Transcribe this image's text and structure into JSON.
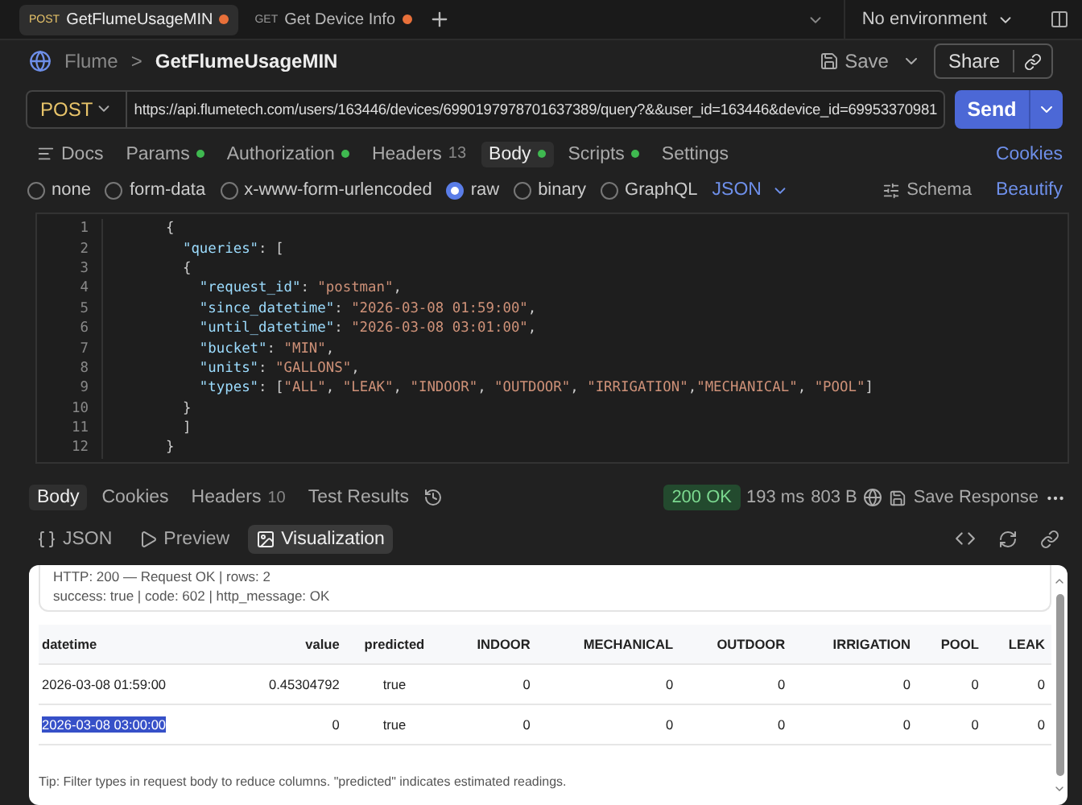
{
  "tabs": [
    {
      "method": "POST",
      "label": "GetFlumeUsageMIN",
      "selected": true,
      "unsaved": true
    },
    {
      "method": "GET",
      "label": "Get Device Info",
      "selected": false,
      "unsaved": true
    }
  ],
  "environment": "No environment",
  "breadcrumb": {
    "collection": "Flume",
    "separator": ">",
    "request": "GetFlumeUsageMIN"
  },
  "header_actions": {
    "save": "Save",
    "share": "Share"
  },
  "request": {
    "method": "POST",
    "url": "https://api.flumetech.com/users/163446/devices/6990197978701637389/query?&&user_id=163446&device_id=69953370981",
    "send": "Send"
  },
  "request_tabs": [
    {
      "label": "Docs",
      "selected": false,
      "dot": false
    },
    {
      "label": "Params",
      "selected": false,
      "dot": true
    },
    {
      "label": "Authorization",
      "selected": false,
      "dot": true
    },
    {
      "label": "Headers",
      "count": "13",
      "selected": false,
      "dot": false
    },
    {
      "label": "Body",
      "selected": true,
      "dot": true
    },
    {
      "label": "Scripts",
      "selected": false,
      "dot": true
    },
    {
      "label": "Settings",
      "selected": false,
      "dot": false
    }
  ],
  "cookies_link": "Cookies",
  "body_types": [
    {
      "label": "none",
      "selected": false
    },
    {
      "label": "form-data",
      "selected": false
    },
    {
      "label": "x-www-form-urlencoded",
      "selected": false
    },
    {
      "label": "raw",
      "selected": true
    },
    {
      "label": "binary",
      "selected": false
    },
    {
      "label": "GraphQL",
      "selected": false
    }
  ],
  "body_format": "JSON",
  "schema": "Schema",
  "beautify": "Beautify",
  "code_lines": [
    {
      "number": "1",
      "text": "{"
    },
    {
      "number": "2",
      "text": "  \"queries\": ["
    },
    {
      "number": "3",
      "text": "  {"
    },
    {
      "number": "4",
      "text": "    \"request_id\": \"postman\","
    },
    {
      "number": "5",
      "text": "    \"since_datetime\": \"2026-03-08 01:59:00\","
    },
    {
      "number": "6",
      "text": "    \"until_datetime\": \"2026-03-08 03:01:00\","
    },
    {
      "number": "7",
      "text": "    \"bucket\": \"MIN\","
    },
    {
      "number": "8",
      "text": "    \"units\": \"GALLONS\","
    },
    {
      "number": "9",
      "text": "    \"types\": [\"ALL\", \"LEAK\", \"INDOOR\", \"OUTDOOR\", \"IRRIGATION\",\"MECHANICAL\", \"POOL\"]"
    },
    {
      "number": "10",
      "text": "  }"
    },
    {
      "number": "11",
      "text": "  ]"
    },
    {
      "number": "12",
      "text": "}"
    }
  ],
  "response_tabs": [
    {
      "label": "Body",
      "selected": true
    },
    {
      "label": "Cookies",
      "selected": false
    },
    {
      "label": "Headers",
      "count": "10",
      "selected": false
    },
    {
      "label": "Test Results",
      "selected": false
    }
  ],
  "response_meta": {
    "status": "200 OK",
    "time": "193 ms",
    "size": "803 B",
    "save_response": "Save Response"
  },
  "view_tabs": [
    {
      "label": "JSON",
      "selected": false
    },
    {
      "label": "Preview",
      "selected": false
    },
    {
      "label": "Visualization",
      "selected": true
    }
  ],
  "visualization": {
    "summary_lines": [
      "HTTP: 200 — Request OK | rows: 2",
      "success: true | code: 602 | http_message: OK"
    ],
    "table": {
      "columns": [
        "datetime",
        "value",
        "predicted",
        "INDOOR",
        "MECHANICAL",
        "OUTDOOR",
        "IRRIGATION",
        "POOL",
        "LEAK"
      ],
      "rows": [
        {
          "cells": [
            "2026-03-08 01:59:00",
            "0.45304792",
            "true",
            "0",
            "0",
            "0",
            "0",
            "0",
            "0"
          ],
          "first_cell_selected": false
        },
        {
          "cells": [
            "2026-03-08 03:00:00",
            "0",
            "true",
            "0",
            "0",
            "0",
            "0",
            "0",
            "0"
          ],
          "first_cell_selected": true
        }
      ]
    },
    "tip": "Tip: Filter types in request body to reduce columns. \"predicted\" indicates estimated readings."
  }
}
